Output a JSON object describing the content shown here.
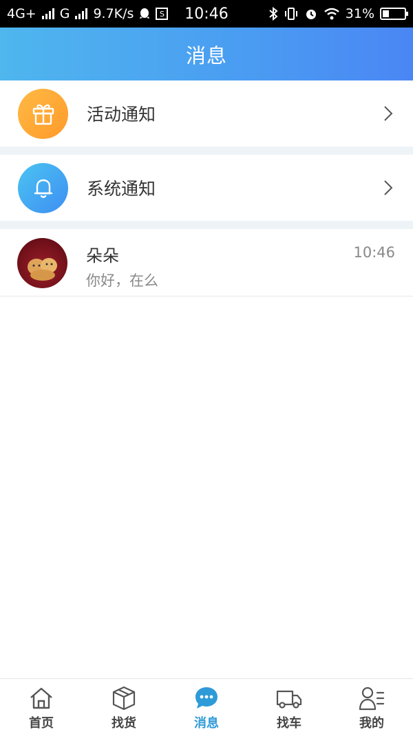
{
  "status_bar": {
    "network_left": "4G+",
    "network_second": "G",
    "speed": "9.7K/s",
    "time": "10:46",
    "battery": "31%",
    "battery_level": 0.31
  },
  "header": {
    "title": "消息"
  },
  "notices": [
    {
      "label": "活动通知",
      "icon": "gift-icon"
    },
    {
      "label": "系统通知",
      "icon": "bell-icon"
    }
  ],
  "chats": [
    {
      "name": "朵朵",
      "time": "10:46",
      "preview": "你好，在么"
    }
  ],
  "tabs": [
    {
      "label": "首页",
      "icon": "home-icon"
    },
    {
      "label": "找货",
      "icon": "box-icon"
    },
    {
      "label": "消息",
      "icon": "chat-bubble-icon",
      "active": true
    },
    {
      "label": "找车",
      "icon": "truck-icon"
    },
    {
      "label": "我的",
      "icon": "profile-icon"
    }
  ],
  "colors": {
    "header_start": "#4fb6ee",
    "header_end": "#4a86f4",
    "active_tab": "#2e9bd8",
    "orange_icon": "#ff9a2a",
    "blue_icon": "#3f8ef2"
  }
}
